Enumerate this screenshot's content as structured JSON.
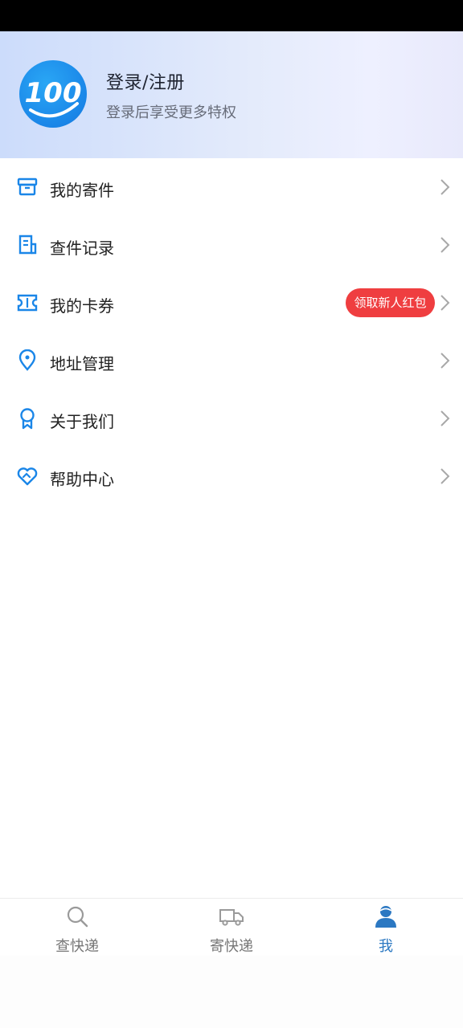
{
  "header": {
    "logo_text": "100",
    "login_title": "登录/注册",
    "login_subtitle": "登录后享受更多特权"
  },
  "menu": {
    "items": [
      {
        "label": "我的寄件",
        "icon": "archive-box-icon"
      },
      {
        "label": "查件记录",
        "icon": "receipt-list-icon"
      },
      {
        "label": "我的卡券",
        "icon": "ticket-icon"
      },
      {
        "label": "地址管理",
        "icon": "location-pin-icon"
      },
      {
        "label": "关于我们",
        "icon": "award-ribbon-icon"
      },
      {
        "label": "帮助中心",
        "icon": "heart-handshake-icon"
      }
    ],
    "promo_badge": "领取新人红包"
  },
  "tabbar": {
    "tabs": [
      {
        "label": "查快递",
        "icon": "search-icon",
        "active": false
      },
      {
        "label": "寄快递",
        "icon": "delivery-truck-icon",
        "active": false
      },
      {
        "label": "我",
        "icon": "user-avatar-icon",
        "active": true
      }
    ]
  },
  "colors": {
    "accent": "#1a86e8",
    "active_tab": "#2b78c2",
    "promo_red": "#ef3e40"
  }
}
